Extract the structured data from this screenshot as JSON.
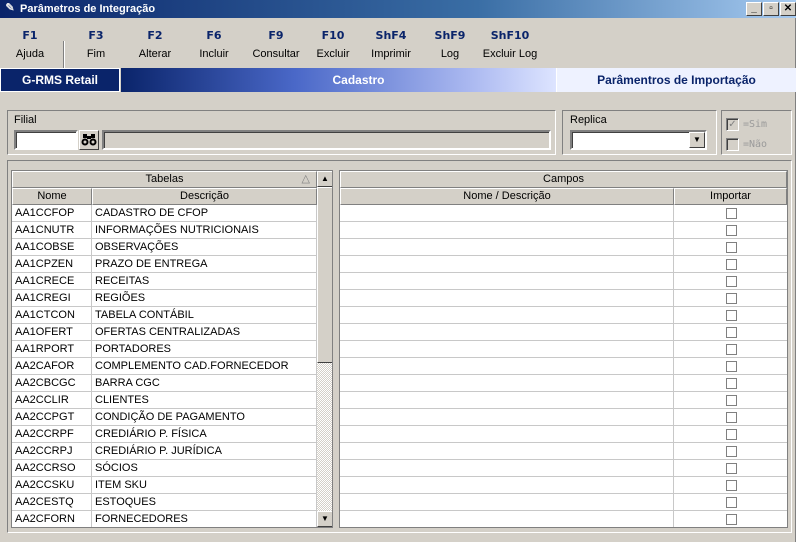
{
  "window": {
    "title": "Parâmetros de Integração",
    "min_label": "_",
    "max_label": "▫",
    "close_label": "✕"
  },
  "fkeys": [
    {
      "key": "F1",
      "label": "Ajuda"
    },
    {
      "key": "F3",
      "label": "Fim"
    },
    {
      "key": "F2",
      "label": "Alterar"
    },
    {
      "key": "F6",
      "label": "Incluir"
    },
    {
      "key": "F9",
      "label": "Consultar"
    },
    {
      "key": "F10",
      "label": "Excluir"
    },
    {
      "key": "ShF4",
      "label": "Imprimir"
    },
    {
      "key": "ShF9",
      "label": "Log"
    },
    {
      "key": "ShF10",
      "label": "Excluir Log"
    }
  ],
  "banner": {
    "brand": "G-RMS Retail",
    "section": "Cadastro",
    "screen": "Parâmentros de Importação"
  },
  "filters": {
    "filial_label": "Filial",
    "filial_value": "",
    "filial_desc": "",
    "replica_label": "Replica",
    "replica_value": "",
    "sim_label": "=Sim",
    "nao_label": "=Não",
    "sim_checked": true,
    "nao_checked": false
  },
  "tabelas": {
    "title": "Tabelas",
    "col_nome": "Nome",
    "col_descricao": "Descrição",
    "rows": [
      {
        "nome": "AA1CCFOP",
        "descricao": "CADASTRO DE CFOP"
      },
      {
        "nome": "AA1CNUTR",
        "descricao": "INFORMAÇÕES NUTRICIONAIS"
      },
      {
        "nome": "AA1COBSE",
        "descricao": "OBSERVAÇÕES"
      },
      {
        "nome": "AA1CPZEN",
        "descricao": "PRAZO DE ENTREGA"
      },
      {
        "nome": "AA1CRECE",
        "descricao": "RECEITAS"
      },
      {
        "nome": "AA1CREGI",
        "descricao": "REGIÕES"
      },
      {
        "nome": "AA1CTCON",
        "descricao": "TABELA CONTÁBIL"
      },
      {
        "nome": "AA1OFERT",
        "descricao": "OFERTAS CENTRALIZADAS"
      },
      {
        "nome": "AA1RPORT",
        "descricao": "PORTADORES"
      },
      {
        "nome": "AA2CAFOR",
        "descricao": "COMPLEMENTO CAD.FORNECEDOR"
      },
      {
        "nome": "AA2CBCGC",
        "descricao": "BARRA CGC"
      },
      {
        "nome": "AA2CCLIR",
        "descricao": "CLIENTES"
      },
      {
        "nome": "AA2CCPGT",
        "descricao": "CONDIÇÃO DE PAGAMENTO"
      },
      {
        "nome": "AA2CCRPF",
        "descricao": "CREDIÁRIO P. FÍSICA"
      },
      {
        "nome": "AA2CCRPJ",
        "descricao": "CREDIÁRIO P. JURÍDICA"
      },
      {
        "nome": "AA2CCRSO",
        "descricao": "SÓCIOS"
      },
      {
        "nome": "AA2CCSKU",
        "descricao": "ITEM SKU"
      },
      {
        "nome": "AA2CESTQ",
        "descricao": "ESTOQUES"
      },
      {
        "nome": "AA2CFORN",
        "descricao": "FORNECEDORES"
      }
    ]
  },
  "campos": {
    "title": "Campos",
    "col_nome": "Nome / Descrição",
    "col_importar": "Importar",
    "rows": 19
  },
  "icons": {
    "app": "feather-icon",
    "search": "binoculars-icon",
    "dropdown": "triangle-down-icon",
    "scroll_up": "triangle-up-icon",
    "scroll_down": "triangle-down-icon"
  }
}
